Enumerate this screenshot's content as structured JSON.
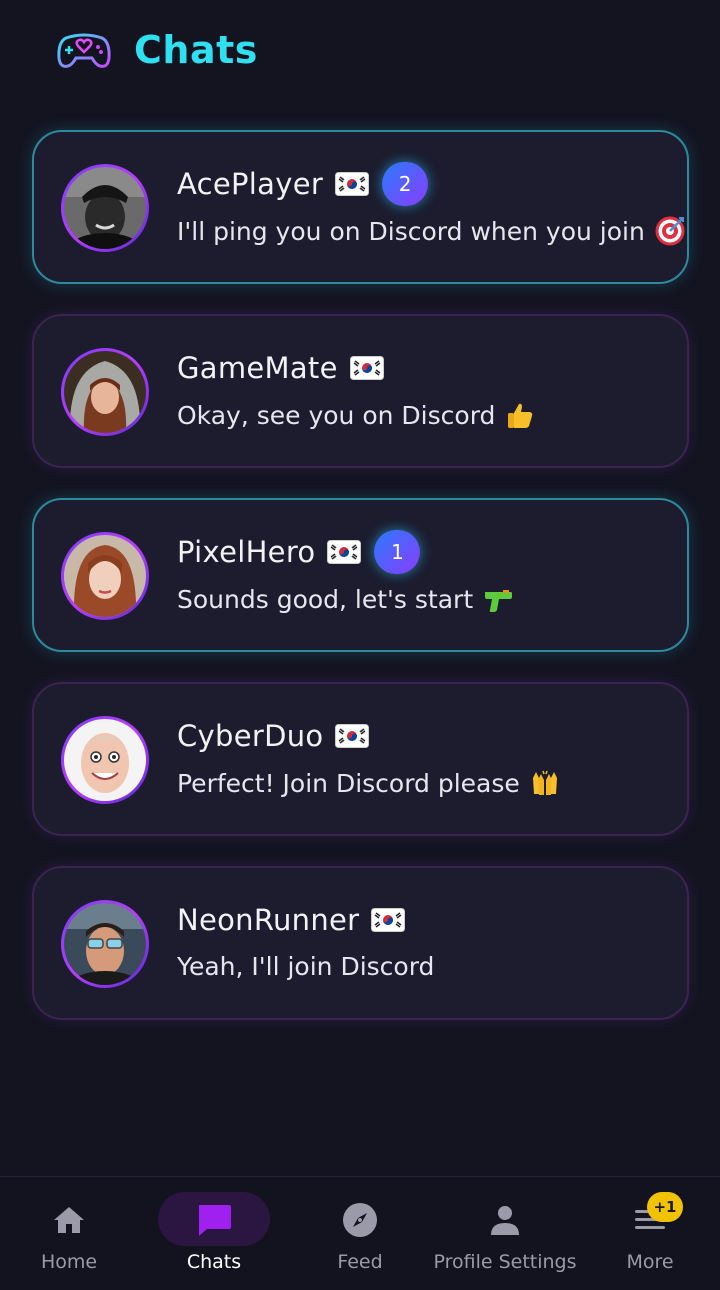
{
  "header": {
    "title": "Chats",
    "logo_icon": "gamepad-heart-icon"
  },
  "chats": [
    {
      "name": "AcePlayer",
      "unread": "2",
      "message": "I'll ping you on Discord when you join",
      "emoji": "target-emoji"
    },
    {
      "name": "GameMate",
      "unread": null,
      "message": "Okay, see you on Discord",
      "emoji": "thumbs-up-emoji"
    },
    {
      "name": "PixelHero",
      "unread": "1",
      "message": "Sounds good, let's start",
      "emoji": "water-pistol-emoji"
    },
    {
      "name": "CyberDuo",
      "unread": null,
      "message": "Perfect! Join Discord please",
      "emoji": "raised-hands-emoji"
    },
    {
      "name": "NeonRunner",
      "unread": null,
      "message": "Yeah, I'll join Discord",
      "emoji": null
    }
  ],
  "nav": {
    "items": [
      {
        "label": "Home",
        "icon": "home-icon"
      },
      {
        "label": "Chats",
        "icon": "chat-bubble-icon"
      },
      {
        "label": "Feed",
        "icon": "compass-icon"
      },
      {
        "label": "Profile Settings",
        "icon": "user-icon"
      },
      {
        "label": "More",
        "icon": "menu-icon"
      }
    ],
    "active": "Chats",
    "more_badge": "+1"
  },
  "colors": {
    "accent": "#2ee0f0",
    "background": "#141421",
    "card": "#1c1c2e",
    "active_nav": "#a020f0",
    "badge_yellow": "#f2c200"
  }
}
